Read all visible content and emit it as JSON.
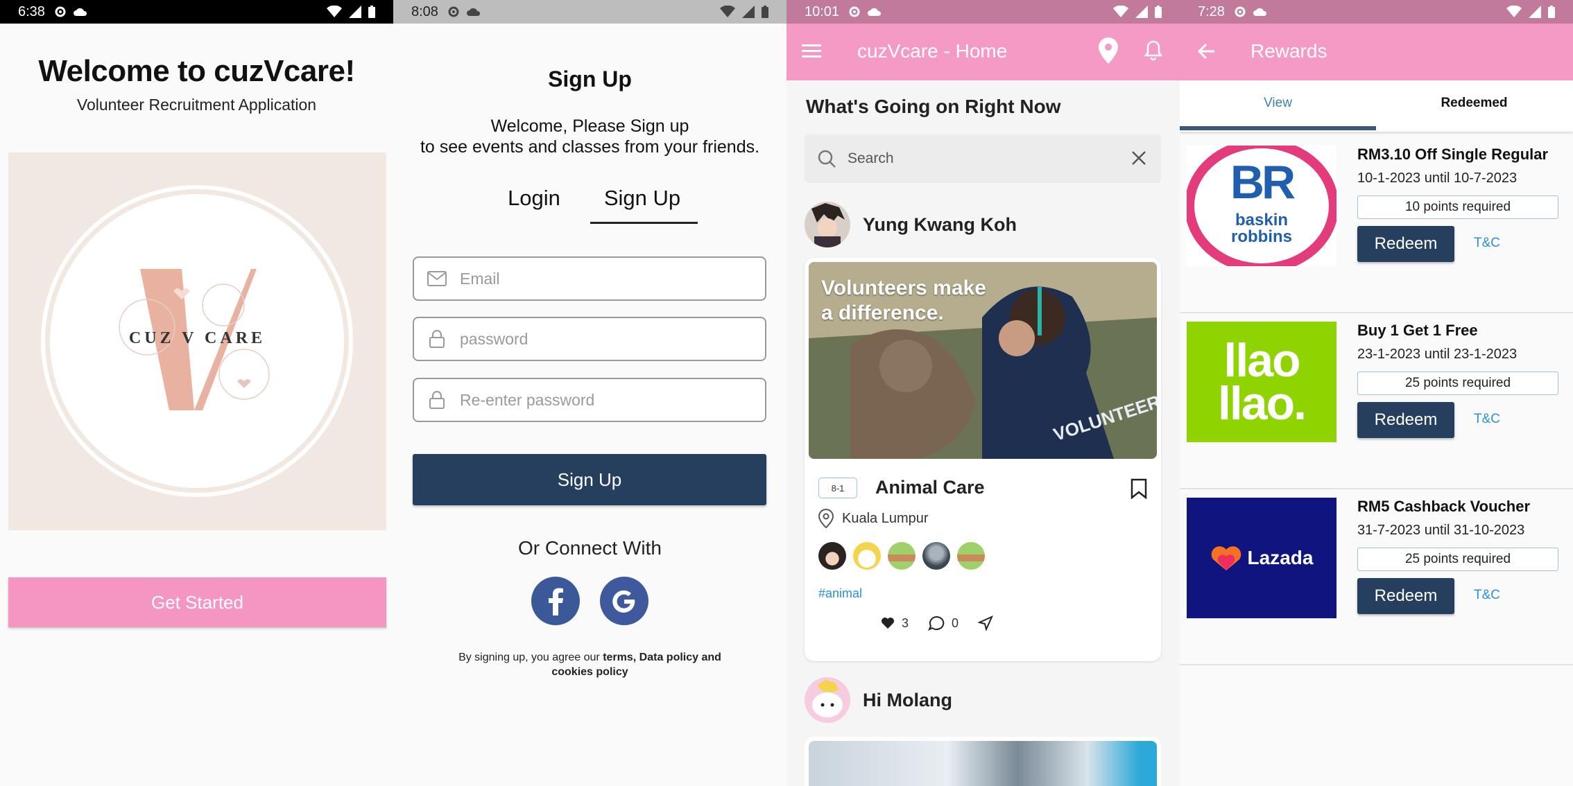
{
  "colors": {
    "pink": "#f596c2",
    "navy": "#273f5e",
    "link": "#2a8fd4"
  },
  "panel1": {
    "status_time": "6:38",
    "title": "Welcome to cuzVcare!",
    "subtitle": "Volunteer Recruitment Application",
    "logo_text": "CUZ V CARE",
    "get_started": "Get Started"
  },
  "panel2": {
    "status_time": "8:08",
    "title": "Sign Up",
    "welcome_line1": "Welcome, Please Sign up",
    "welcome_line2": "to see events and classes from your friends.",
    "tab_login": "Login",
    "tab_signup": "Sign Up",
    "email_placeholder": "Email",
    "password_placeholder": "password",
    "reenter_placeholder": "Re-enter password",
    "signup_button": "Sign Up",
    "connect_with": "Or Connect With",
    "legal_prefix": "By signing up, you agree our ",
    "legal_bold1": "terms, Data policy and",
    "legal_bold2": "cookies policy"
  },
  "panel3": {
    "status_time": "10:01",
    "app_title": "cuzVcare - Home",
    "heading": "What's Going on Right Now",
    "search_placeholder": "Search",
    "post1": {
      "author": "Yung Kwang Koh",
      "image_text_line1": "Volunteers make",
      "image_text_line2": "a difference.",
      "shirt_text": "VOLUNTEER",
      "date_badge": "8-1",
      "title": "Animal Care",
      "location": "Kuala Lumpur",
      "hashtag": "#animal",
      "likes": "3",
      "comments": "0"
    },
    "post2": {
      "author": "Hi Molang"
    }
  },
  "panel4": {
    "status_time": "7:28",
    "title": "Rewards",
    "tab_view": "View",
    "tab_redeemed": "Redeemed",
    "redeem_label": "Redeem",
    "tc_label": "T&C",
    "rewards": [
      {
        "title": "RM3.10 Off Single Regular",
        "dates": "10-1-2023 until 10-7-2023",
        "points": "10 points required",
        "brand_logo_a": "BR",
        "brand_logo_b": "baskin",
        "brand_logo_c": "robbins"
      },
      {
        "title": "Buy 1 Get 1 Free",
        "dates": "23-1-2023 until 23-1-2023",
        "points": "25 points required",
        "brand_logo_a": "llao",
        "brand_logo_b": "llao."
      },
      {
        "title": "RM5 Cashback Voucher",
        "dates": "31-7-2023 until 31-10-2023",
        "points": "25 points required",
        "brand_logo_a": "Lazada"
      }
    ]
  }
}
